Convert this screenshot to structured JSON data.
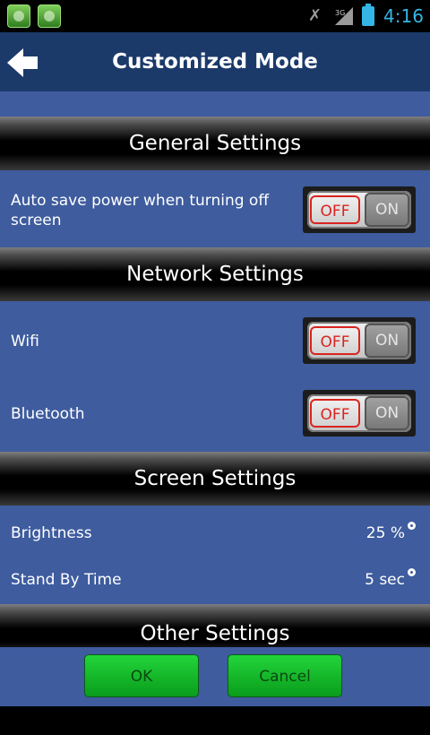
{
  "status_bar": {
    "network_type": "3G",
    "time": "4:16",
    "accent_color": "#35b5e5"
  },
  "title_bar": {
    "back_icon": "back-arrow-icon",
    "title": "Customized Mode"
  },
  "sections": {
    "general": {
      "title": "General Settings",
      "auto_save": {
        "label": "Auto save power when turning off screen",
        "off_label": "OFF",
        "on_label": "ON",
        "state": "OFF"
      }
    },
    "network": {
      "title": "Network Settings",
      "wifi": {
        "label": "Wifi",
        "off_label": "OFF",
        "on_label": "ON",
        "state": "OFF"
      },
      "bluetooth": {
        "label": "Bluetooth",
        "off_label": "OFF",
        "on_label": "ON",
        "state": "OFF"
      }
    },
    "screen": {
      "title": "Screen Settings",
      "brightness": {
        "label": "Brightness",
        "value": "25 %"
      },
      "standby": {
        "label": "Stand By Time",
        "value": "5 sec"
      }
    },
    "other": {
      "title": "Other Settings"
    }
  },
  "footer": {
    "ok_label": "OK",
    "cancel_label": "Cancel"
  },
  "colors": {
    "background": "#3e5c9e",
    "title_bar": "#1b3a6a",
    "toggle_off_text": "#d9241f",
    "button_green": "#16b82b"
  }
}
